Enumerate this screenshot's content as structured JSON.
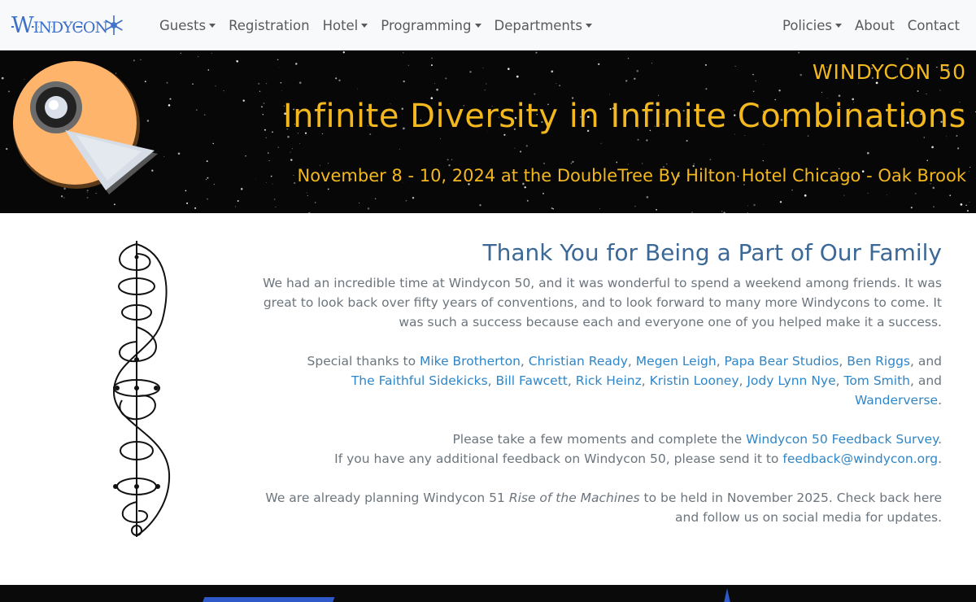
{
  "brand": {
    "logo_text": "Windycon"
  },
  "nav": {
    "left": [
      {
        "label": "Guests",
        "dropdown": true
      },
      {
        "label": "Registration",
        "dropdown": false
      },
      {
        "label": "Hotel",
        "dropdown": true
      },
      {
        "label": "Programming",
        "dropdown": true
      },
      {
        "label": "Departments",
        "dropdown": true
      }
    ],
    "right": [
      {
        "label": "Policies",
        "dropdown": true
      },
      {
        "label": "About",
        "dropdown": false
      },
      {
        "label": "Contact",
        "dropdown": false
      }
    ]
  },
  "banner": {
    "edition": "WINDYCON 50",
    "title": "Infinite Diversity in Infinite Combinations",
    "dates": "November 8 - 10, 2024 at the DoubleTree By Hilton Hotel Chicago - Oak Brook"
  },
  "main": {
    "heading": "Thank You for Being a Part of Our Family",
    "intro": "We had an incredible time at Windycon 50, and it was wonderful to spend a weekend among friends. It was great to look back over fifty years of conventions, and to look forward to many more Windycons to come. It was such a success because each and everyone one of you helped make it a success.",
    "thanks_prefix": "Special thanks to ",
    "thanks_links": [
      "Mike Brotherton",
      "Christian Ready",
      "Megen Leigh",
      "Papa Bear Studios",
      "Ben Riggs",
      "The Faithful Sidekicks",
      "Bill Fawcett",
      "Rick Heinz",
      "Kristin Looney",
      "Jody Lynn Nye",
      "Tom Smith",
      "Wanderverse"
    ],
    "sep_comma": ", ",
    "sep_and": ", and ",
    "period": ".",
    "survey_prefix": "Please take a few moments and complete the ",
    "survey_link": "Windycon 50 Feedback Survey",
    "feedback_prefix": "If you have any additional feedback on Windycon 50, please send it to ",
    "feedback_email": "feedback@windycon.org",
    "planning_prefix": "We are already planning Windycon 51 ",
    "planning_theme": "Rise of the Machines",
    "planning_suffix": " to be held in November 2025. Check back here and follow us on social media for updates."
  },
  "colors": {
    "nav_bg": "#f8f9fa",
    "brand_blue": "#3d6fc7",
    "banner_gold": "#f3b81e",
    "heading": "#3b6896",
    "link": "#2f86c8",
    "body_text": "#6c757d"
  }
}
